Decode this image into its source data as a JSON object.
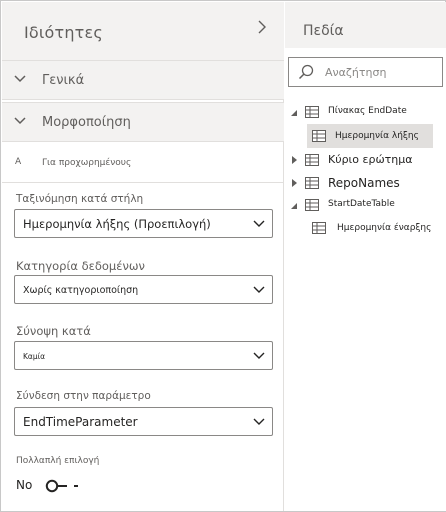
{
  "properties_pane": {
    "title": "Ιδιότητες",
    "sections": {
      "general": "Γενικά",
      "formatting": "Μορφοποίηση",
      "advanced": "Για προχωρημένους"
    },
    "advanced_icon_text": "A",
    "sort_by": {
      "label": "Ταξινόμηση κατά στήλη",
      "value": "Ημερομηνία λήξης (Προεπιλογή)"
    },
    "data_category": {
      "label": "Κατηγορία δεδομένων",
      "value": "Χωρίς κατηγοριοποίηση"
    },
    "summarize_by": {
      "label": "Σύνοψη κατά",
      "value": "Καμία"
    },
    "bind_to_parameter": {
      "label": "Σύνδεση στην παράμετρο",
      "value": "EndTimeParameter"
    },
    "multi_select": {
      "label": "Πολλαπλή επιλογή",
      "state_text": "No"
    }
  },
  "fields_pane": {
    "title": "Πεδία",
    "search_placeholder": "Αναζήτηση",
    "tree": [
      {
        "label": "Πίνακας EndDate",
        "expanded": true
      },
      {
        "label": "Ημερομηνία λήξης",
        "selected": true
      },
      {
        "label": "Κύριο ερώτημα",
        "expanded": false
      },
      {
        "label": "RepoNames",
        "expanded": false
      },
      {
        "label": "StartDateTable",
        "expanded": true
      },
      {
        "label": "Ημερομηνία έναρξης"
      }
    ]
  },
  "colors": {
    "header_bg": "#f3f2f1",
    "border": "#8a8886",
    "selected_row": "#e1dfdd",
    "text_secondary": "#605e5c",
    "text_primary": "#252423"
  }
}
